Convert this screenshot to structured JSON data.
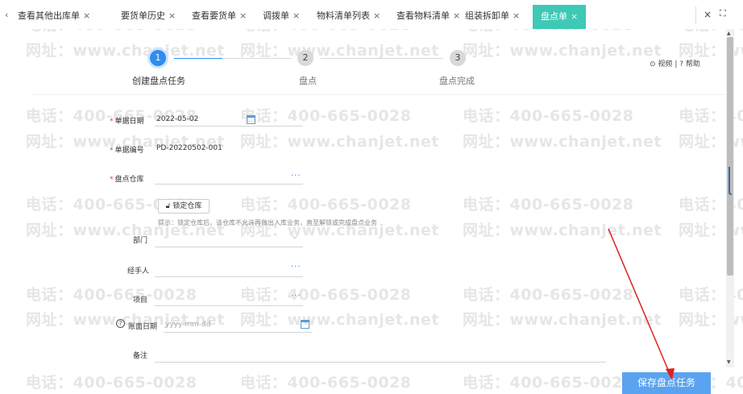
{
  "tabs": [
    {
      "label": "查看其他出库单",
      "close": "×",
      "active": false
    },
    {
      "label": "要货单历史",
      "close": "×",
      "active": false
    },
    {
      "label": "查看要货单",
      "close": "×",
      "active": false
    },
    {
      "label": "调拨单",
      "close": "×",
      "active": false
    },
    {
      "label": "物料清单列表",
      "close": "×",
      "active": false
    },
    {
      "label": "查看物料清单",
      "close": "×",
      "active": false
    },
    {
      "label": "组装拆卸单",
      "close": "×",
      "active": false
    },
    {
      "label": "盘点单",
      "close": "×",
      "active": true
    }
  ],
  "tabbar": {
    "scroll_left": "‹",
    "close_all": "×",
    "fullscreen": "⛶"
  },
  "watermark": {
    "phone": "电话：400-665-0028",
    "site": "网址：www.chanjet.net"
  },
  "steps": [
    {
      "number": "1",
      "label": "创建盘点任务",
      "state": "active"
    },
    {
      "number": "2",
      "label": "盘点",
      "state": "todo"
    },
    {
      "number": "3",
      "label": "盘点完成",
      "state": "todo"
    }
  ],
  "help": {
    "video": "视频",
    "separator": "|",
    "help": "帮助"
  },
  "form": {
    "doc_date": {
      "label": "单据日期",
      "required": "*",
      "value": "2022-05-02"
    },
    "doc_no": {
      "label": "单据编号",
      "required": "*",
      "value": "PD-20220502-001"
    },
    "warehouse": {
      "label": "盘点仓库",
      "required": "*",
      "value": "",
      "more": "···"
    },
    "lock_button": "锁定仓库",
    "lock_hint": "提示：锁定仓库后，该仓库不允许再做出入库业务，直至解锁或完成盘点业务",
    "department": {
      "label": "部门",
      "value": ""
    },
    "handler": {
      "label": "经手人",
      "value": "",
      "more": "···"
    },
    "project": {
      "label": "项目",
      "value": "",
      "more": "···"
    },
    "book_date": {
      "label": "账面日期",
      "placeholder": "yyyy-mm-dd"
    },
    "remark": {
      "label": "备注",
      "value": ""
    }
  },
  "save_button": "保存盘点任务",
  "colors": {
    "accent": "#3ec9b6",
    "primary": "#2f8cf0",
    "required": "#e53935",
    "save": "#5aa3f0",
    "annotation": "#e02020"
  }
}
